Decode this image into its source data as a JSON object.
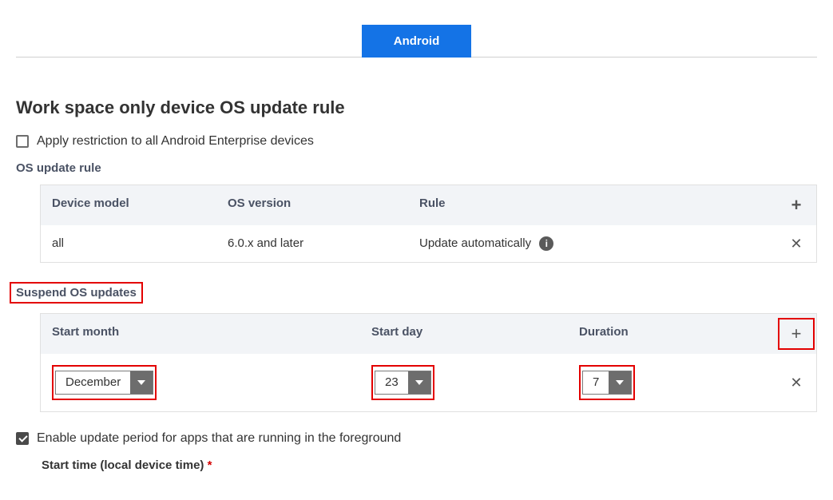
{
  "tab": {
    "label": "Android"
  },
  "section": {
    "title": "Work space only device OS update rule",
    "apply_restriction_label": "Apply restriction to all Android Enterprise devices",
    "apply_restriction_checked": false
  },
  "os_update_rule": {
    "heading": "OS update rule",
    "columns": {
      "device_model": "Device model",
      "os_version": "OS version",
      "rule": "Rule"
    },
    "rows": [
      {
        "device_model": "all",
        "os_version": "6.0.x and later",
        "rule": "Update automatically"
      }
    ]
  },
  "suspend": {
    "heading": "Suspend OS updates",
    "columns": {
      "start_month": "Start month",
      "start_day": "Start day",
      "duration": "Duration"
    },
    "rows": [
      {
        "start_month": "December",
        "start_day": "23",
        "duration": "7"
      }
    ]
  },
  "footer": {
    "enable_update_period_label": "Enable update period for apps that are running in the foreground",
    "enable_update_period_checked": true,
    "start_time_label": "Start time (local device time)",
    "required_marker": "*"
  },
  "icons": {
    "info": "i",
    "plus": "+",
    "close": "✕"
  }
}
